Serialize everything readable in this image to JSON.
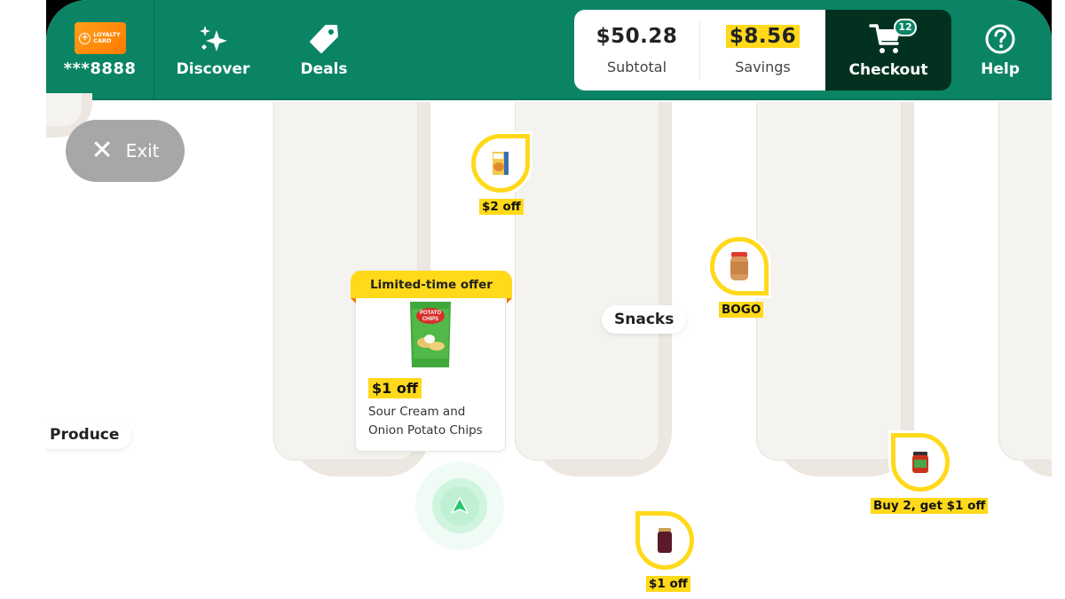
{
  "header": {
    "loyalty": {
      "card_line1": "LOYALTY",
      "card_line2": "CARD",
      "number": "***8888",
      "icon": "loyalty-card-icon"
    },
    "discover": {
      "label": "Discover",
      "icon": "sparkles-icon"
    },
    "deals": {
      "label": "Deals",
      "icon": "tag-icon"
    },
    "subtotal": {
      "value": "$50.28",
      "label": "Subtotal"
    },
    "savings": {
      "value": "$8.56",
      "label": "Savings",
      "highlight_color": "#ffd91a"
    },
    "checkout": {
      "label": "Checkout",
      "cart_count": "12",
      "icon": "cart-icon"
    },
    "help": {
      "label": "Help",
      "icon": "help-circle-icon"
    },
    "brand_color": "#0a8464",
    "checkout_color": "#02321f"
  },
  "map": {
    "exit_label": "Exit",
    "aisles": [
      {
        "label": "Produce"
      },
      {
        "label": "Snacks"
      }
    ],
    "deal_pins": [
      {
        "product": "cereal box",
        "tag": "$2 off"
      },
      {
        "product": "peanut butter jar",
        "tag": "BOGO"
      },
      {
        "product": "salsa jar",
        "tag": "Buy 2, get $1 off"
      },
      {
        "product": "jam jar",
        "tag": "$1 off"
      }
    ],
    "featured_offer": {
      "banner": "Limited-time offer",
      "discount": "$1 off",
      "name": "Sour Cream and Onion Potato Chips",
      "bag_text_1": "POTATO",
      "bag_text_2": "CHIPS"
    },
    "location_marker": "you-are-here"
  }
}
